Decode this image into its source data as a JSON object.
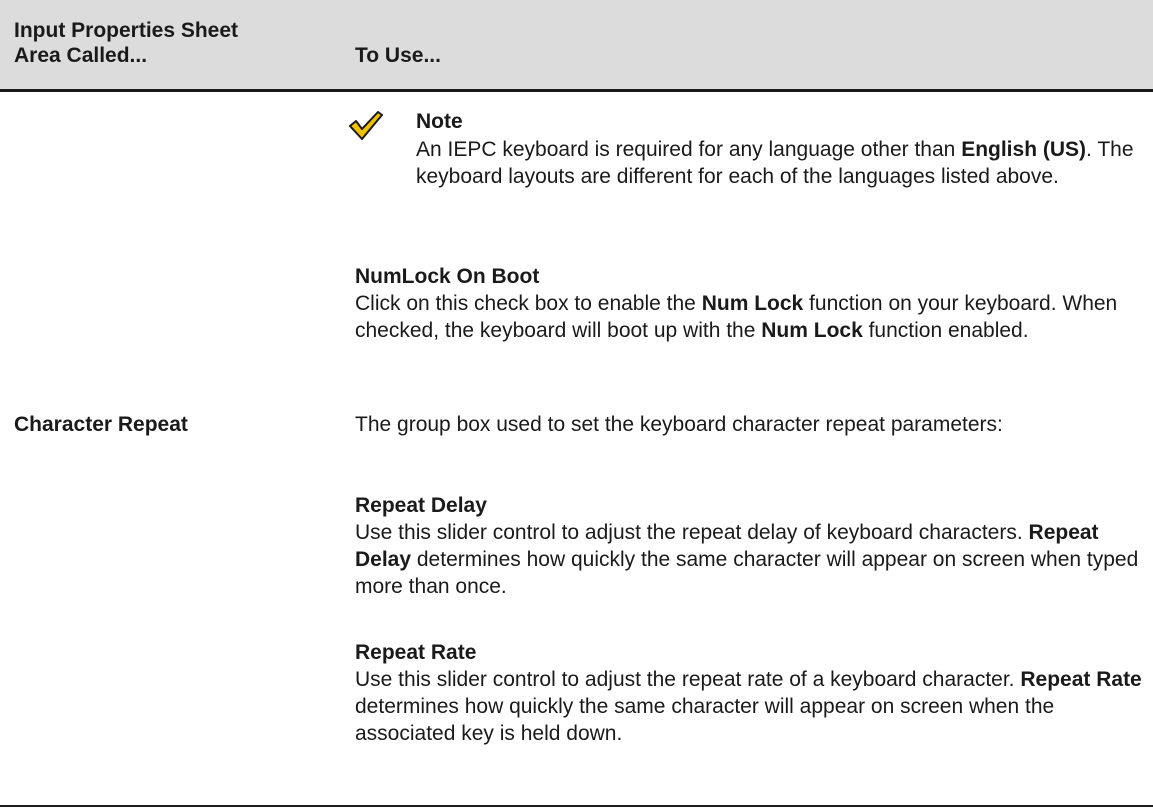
{
  "table": {
    "header": {
      "col1_line1": "Input Properties Sheet",
      "col1_line2": "Area Called...",
      "col2": "To Use..."
    },
    "note": {
      "icon": "checkmark-icon",
      "title": "Note",
      "text_1": "An IEPC keyboard is required for any language other than",
      "bold_1": "English (US)",
      "text_2": ". The keyboard layouts are different for each of the languages listed above."
    },
    "numlock": {
      "title": "NumLock On Boot",
      "text_1": "Click on this check box to enable the ",
      "bold_1": "Num Lock",
      "text_2": " function on your keyboard. When checked, the keyboard will boot up with the ",
      "bold_2": "Num Lock",
      "text_3": " function enabled."
    },
    "character_repeat": {
      "label": "Character Repeat",
      "description": "The group box used to set the keyboard character repeat parameters:"
    },
    "repeat_delay": {
      "title": "Repeat Delay",
      "text_1": "Use this slider control to adjust the repeat delay of keyboard characters. ",
      "bold_1": "Repeat Delay",
      "text_2": " determines how quickly the same character will appear on screen when typed more than once."
    },
    "repeat_rate": {
      "title": "Repeat Rate",
      "text_1": "Use this slider control to adjust the repeat rate of a keyboard character. ",
      "bold_1": "Repeat Rate",
      "text_2": " determines how quickly the same character will appear on screen when the associated key is held down."
    }
  },
  "colors": {
    "header_bg": "#dcdcdc",
    "text": "#1a1a1a",
    "check_fill": "#f2c200",
    "check_stroke": "#1a1a1a"
  }
}
